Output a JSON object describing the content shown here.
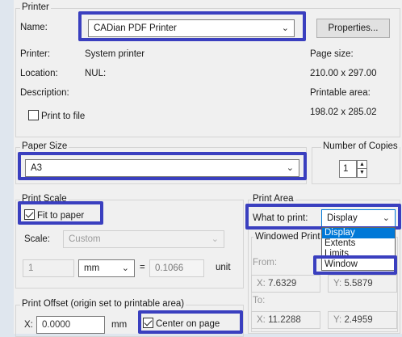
{
  "printer": {
    "group_title": "Printer",
    "name_label": "Name:",
    "name_value": "CADian PDF Printer",
    "properties_button": "Properties...",
    "printer_label": "Printer:",
    "printer_value": "System printer",
    "location_label": "Location:",
    "location_value": "NUL:",
    "description_label": "Description:",
    "print_to_file": "Print to file",
    "print_to_file_checked": false,
    "page_size_label": "Page size:",
    "page_size_value": "210.00 x 297.00",
    "printable_area_label": "Printable area:",
    "printable_area_value": "198.02 x 285.02"
  },
  "paper_size": {
    "group_title": "Paper Size",
    "value": "A3"
  },
  "copies": {
    "group_title": "Number of Copies",
    "value": "1"
  },
  "print_scale": {
    "group_title": "Print Scale",
    "fit_to_paper": "Fit to paper",
    "fit_to_paper_checked": true,
    "scale_label": "Scale:",
    "scale_value": "Custom",
    "left_value": "1",
    "unit_select": "mm",
    "equals": "=",
    "right_value": "0.1066",
    "unit_label": "unit"
  },
  "print_area": {
    "group_title": "Print Area",
    "what_label": "What to print:",
    "what_value": "Display",
    "dropdown_options": [
      "Display",
      "Extents",
      "Limits",
      "Window"
    ],
    "dropdown_selected": "Display",
    "windowed_title": "Windowed Print",
    "from_label": "From:",
    "from_x_label": "X:",
    "from_x_value": "7.6329",
    "from_y_label": "Y:",
    "from_y_value": "5.5879",
    "to_label": "To:",
    "to_x_label": "X:",
    "to_x_value": "11.2288",
    "to_y_label": "Y:",
    "to_y_value": "2.4959"
  },
  "print_offset": {
    "group_title": "Print Offset (origin set to printable area)",
    "x_label": "X:",
    "x_value": "0.0000",
    "x_unit": "mm",
    "center_on_page": "Center on page",
    "center_on_page_checked": true
  },
  "colors": {
    "highlight": "#3a3fbf",
    "selection": "#0078d7",
    "dialog_bg": "#f0f0f0"
  }
}
